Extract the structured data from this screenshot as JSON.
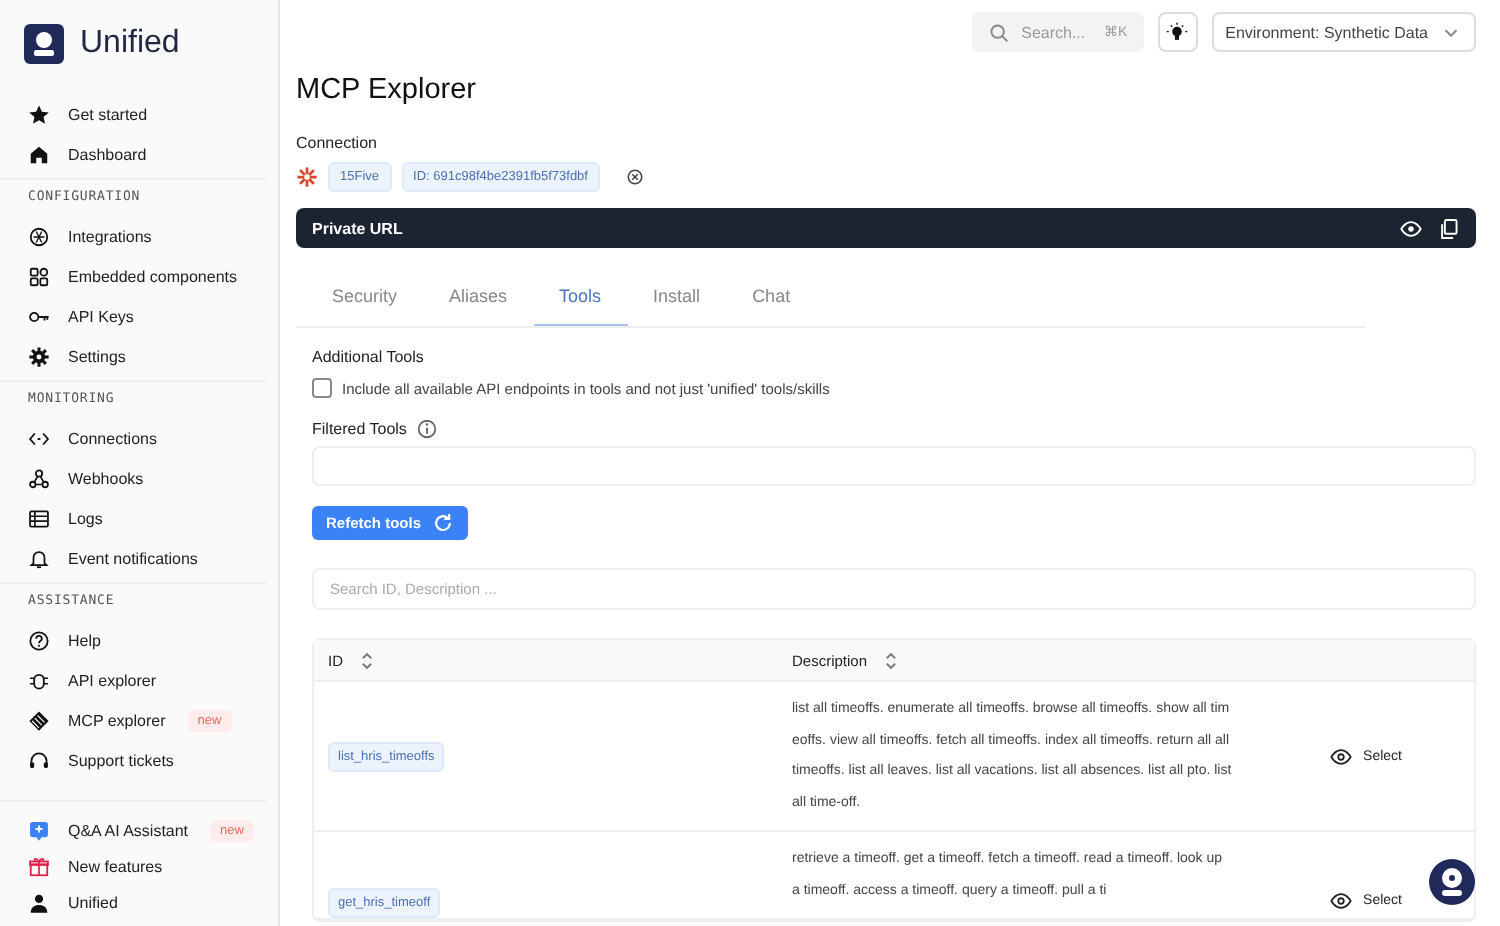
{
  "sidebar": {
    "brand": "Unified",
    "groups": [
      {
        "items": [
          {
            "label": "Get started"
          },
          {
            "label": "Dashboard"
          }
        ]
      },
      {
        "heading": "CONFIGURATION",
        "items": [
          {
            "label": "Integrations"
          },
          {
            "label": "Embedded components"
          },
          {
            "label": "API Keys"
          },
          {
            "label": "Settings"
          }
        ]
      },
      {
        "heading": "MONITORING",
        "items": [
          {
            "label": "Connections"
          },
          {
            "label": "Webhooks"
          },
          {
            "label": "Logs"
          },
          {
            "label": "Event notifications"
          }
        ]
      },
      {
        "heading": "ASSISTANCE",
        "items": [
          {
            "label": "Help"
          },
          {
            "label": "API explorer"
          },
          {
            "label": "MCP explorer",
            "badge": "new"
          },
          {
            "label": "Support tickets"
          }
        ]
      }
    ],
    "footer": [
      {
        "label": "Q&A AI Assistant",
        "badge": "new"
      },
      {
        "label": "New features"
      },
      {
        "label": "Unified"
      }
    ]
  },
  "topbar": {
    "search": {
      "placeholder": "Search...",
      "shortcut": "⌘K"
    },
    "environment": "Environment: Synthetic Data"
  },
  "title": "MCP Explorer",
  "connection": {
    "label": "Connection",
    "name": "15Five",
    "id": "ID: 691c98f4be2391fb5f73fdbf"
  },
  "private_url": {
    "label": "Private URL"
  },
  "tabs": [
    {
      "label": "Security",
      "selected": false
    },
    {
      "label": "Aliases",
      "selected": false
    },
    {
      "label": "Tools",
      "selected": true
    },
    {
      "label": "Install",
      "selected": false
    },
    {
      "label": "Chat",
      "selected": false
    }
  ],
  "additional_tools": {
    "heading": "Additional Tools",
    "checkbox": {
      "label": "Include all available API endpoints in tools and not just 'unified' tools/skills",
      "checked": false
    }
  },
  "filtered_tools": {
    "label": "Filtered Tools"
  },
  "refetch_button": "Refetch tools",
  "table_search": {
    "placeholder": "Search ID, Description ..."
  },
  "table": {
    "columns": [
      "ID",
      "Description"
    ],
    "rows": [
      {
        "id": "list_hris_timeoffs",
        "description": "list all timeoffs. enumerate all timeoffs. browse all timeoffs. show all timeoffs. view all timeoffs. fetch all timeoffs. index all timeoffs. return all all timeoffs. list all leaves. list all vacations. list all absences. list all pto. list all time-off.",
        "action": "Select"
      },
      {
        "id": "get_hris_timeoff",
        "description": "retrieve a timeoff. get a timeoff. fetch a timeoff. read a timeoff. look up a timeoff. access a timeoff. query a timeoff. pull a ti",
        "action": "Select"
      }
    ]
  }
}
